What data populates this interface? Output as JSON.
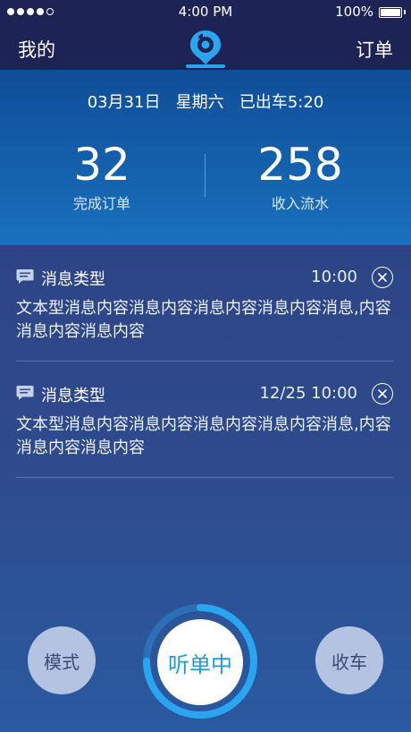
{
  "status_bar": {
    "time": "4:00 PM",
    "battery_percent": "100%",
    "signal_bars": 4,
    "signal_total": 5
  },
  "nav": {
    "left_label": "我的",
    "right_label": "订单",
    "logo_icon": "location-pin-logo-icon",
    "accent_color": "#2aa5f0"
  },
  "summary": {
    "date": "03月31日",
    "weekday": "星期六",
    "status": "已出车5:20",
    "orders_value": "32",
    "orders_label": "完成订单",
    "income_value": "258",
    "income_label": "收入流水"
  },
  "messages": [
    {
      "type": "消息类型",
      "time": "10:00",
      "text": "文本型消息内容消息内容消息内容消息内容消息,内容消息内容消息内容",
      "icon": "message-icon"
    },
    {
      "type": "消息类型",
      "time": "12/25 10:00",
      "text": "文本型消息内容消息内容消息内容消息内容消息,内容消息内容消息内容",
      "icon": "message-icon"
    }
  ],
  "controls": {
    "mode_label": "模式",
    "listen_label": "听单中",
    "finish_label": "收车",
    "listen_color": "#1f9ad8"
  }
}
